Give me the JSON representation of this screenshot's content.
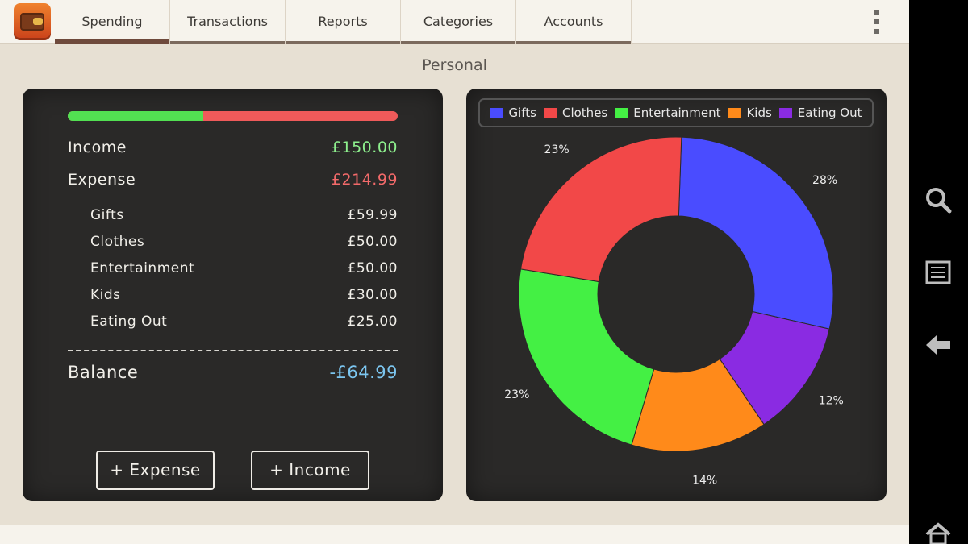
{
  "tabs": [
    {
      "label": "Spending",
      "active": true
    },
    {
      "label": "Transactions",
      "active": false
    },
    {
      "label": "Reports",
      "active": false
    },
    {
      "label": "Categories",
      "active": false
    },
    {
      "label": "Accounts",
      "active": false
    }
  ],
  "page_title": "Personal",
  "summary": {
    "income_label": "Income",
    "income_value": "£150.00",
    "expense_label": "Expense",
    "expense_value": "£214.99",
    "income_share": 0.411,
    "categories": [
      {
        "label": "Gifts",
        "value": "£59.99"
      },
      {
        "label": "Clothes",
        "value": "£50.00"
      },
      {
        "label": "Entertainment",
        "value": "£50.00"
      },
      {
        "label": "Kids",
        "value": "£30.00"
      },
      {
        "label": "Eating Out",
        "value": "£25.00"
      }
    ],
    "balance_label": "Balance",
    "balance_value": "-£64.99"
  },
  "buttons": {
    "add_expense": "+ Expense",
    "add_income": "+ Income"
  },
  "colors": {
    "income": "#8ef08e",
    "expense": "#f36a6a",
    "balance": "#7cc6f0",
    "tab_active": "#6f4a3c"
  },
  "chart_data": {
    "type": "pie",
    "donut": true,
    "legend_position": "top",
    "series": [
      {
        "name": "Gifts",
        "value": 28,
        "label": "28%",
        "color": "#4a4cff"
      },
      {
        "name": "Kids",
        "value": 12,
        "label": "12%",
        "color": "#8a2be2"
      },
      {
        "name": "Clothes",
        "value": 14,
        "label": "14%",
        "color": "#ff8a1a"
      },
      {
        "name": "Entertainment",
        "value": 23,
        "label": "23%",
        "color": "#44f044"
      },
      {
        "name": "Eating Out",
        "value": 23,
        "label": "23%",
        "color": "#f24848"
      }
    ],
    "legend": [
      {
        "name": "Gifts",
        "color": "#4a4cff"
      },
      {
        "name": "Clothes",
        "color": "#f24848"
      },
      {
        "name": "Entertainment",
        "color": "#44f044"
      },
      {
        "name": "Kids",
        "color": "#ff8a1a"
      },
      {
        "name": "Eating Out",
        "color": "#8a2be2"
      }
    ]
  },
  "system_nav": [
    "search-icon",
    "menu-icon",
    "back-icon",
    "home-icon"
  ]
}
